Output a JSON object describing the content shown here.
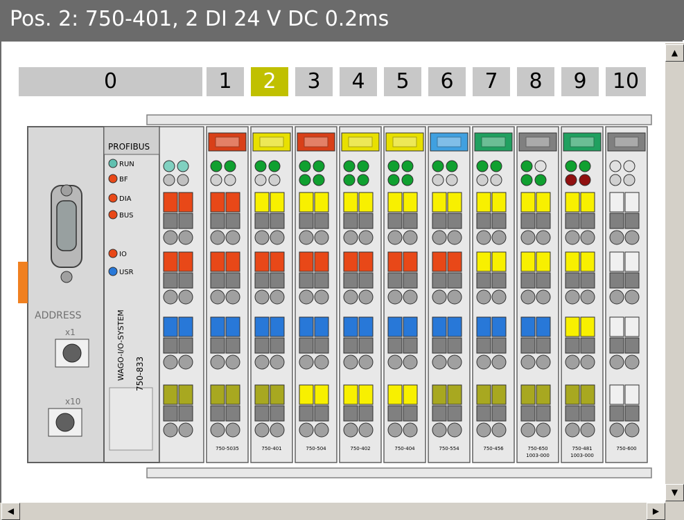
{
  "window": {
    "title": "Pos. 2: 750-401, 2 DI 24 V DC 0.2ms"
  },
  "position_bar": {
    "selected": "2",
    "labels": [
      "0",
      "1",
      "2",
      "3",
      "4",
      "5",
      "6",
      "7",
      "8",
      "9",
      "10"
    ]
  },
  "coupler": {
    "bus_label": "PROFIBUS",
    "leds": [
      "RUN",
      "BF",
      "DIA",
      "BUS",
      "IO",
      "USR"
    ],
    "address_label": "ADDRESS",
    "switch_x1": "x1",
    "switch_x10": "x10",
    "brand_text": "WAGO-I/O-SYSTEM",
    "model": "750-833"
  },
  "modules": [
    {
      "pos": "1",
      "part": "750-5035",
      "cap": "#d84018"
    },
    {
      "pos": "2",
      "part": "750-401",
      "cap": "#e8e000"
    },
    {
      "pos": "3",
      "part": "750-504",
      "cap": "#d84018"
    },
    {
      "pos": "4",
      "part": "750-402",
      "cap": "#e8e000"
    },
    {
      "pos": "5",
      "part": "750-404",
      "cap": "#e8e000"
    },
    {
      "pos": "6",
      "part": "750-554",
      "cap": "#40a0e0"
    },
    {
      "pos": "7",
      "part": "750-456",
      "cap": "#20a060"
    },
    {
      "pos": "8",
      "part": "750-650 1003-000",
      "cap": "#808080"
    },
    {
      "pos": "9",
      "part": "750-481 1003-000",
      "cap": "#20a060"
    },
    {
      "pos": "10",
      "part": "750-600",
      "cap": "#808080"
    }
  ],
  "colors": {
    "accent_selected": "#c0c000",
    "red": "#e84818",
    "yellow": "#f8f000",
    "blue": "#2878d8",
    "olive": "#a8a820",
    "green_led": "#10a030",
    "red_led": "#e84818",
    "dark_red_led": "#901010"
  },
  "scrollbars": {
    "up_arrow": "▲",
    "down_arrow": "▼",
    "left_arrow": "◀",
    "right_arrow": "▶"
  }
}
